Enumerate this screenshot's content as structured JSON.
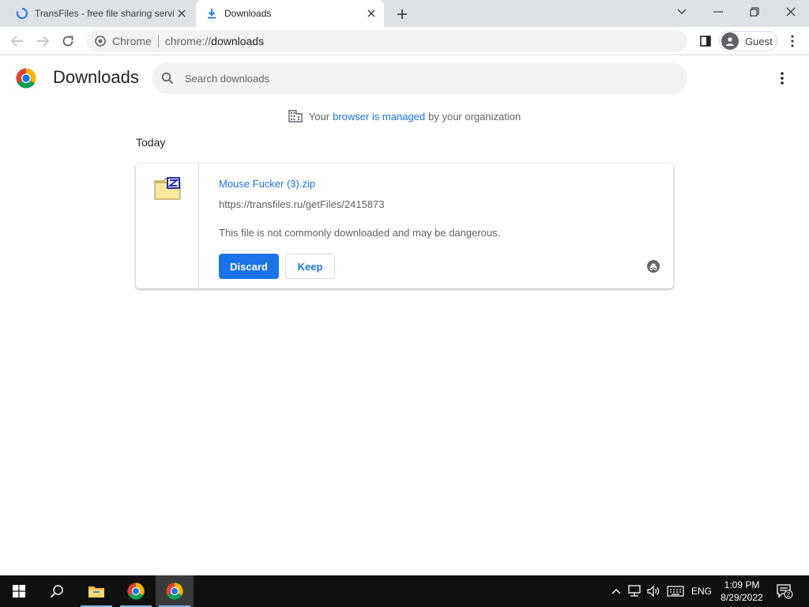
{
  "browser": {
    "tabs": [
      {
        "title": "TransFiles - free file sharing servi",
        "icon": "loading-spinner-icon",
        "active": false
      },
      {
        "title": "Downloads",
        "icon": "download-icon",
        "active": true
      }
    ],
    "omnibox": {
      "site_chip": "Chrome",
      "url_scheme": "chrome://",
      "url_path": "downloads"
    },
    "profile": {
      "label": "Guest"
    }
  },
  "page": {
    "title": "Downloads",
    "search": {
      "placeholder": "Search downloads"
    },
    "managed_notice": {
      "prefix": "Your",
      "link": "browser is managed",
      "suffix": "by your organization"
    },
    "date_group": "Today",
    "download": {
      "file_name": "Mouse Fucker (3).zip",
      "url": "https://transfiles.ru/getFiles/2415873",
      "warning": "This file is not commonly downloaded and may be dangerous.",
      "discard_label": "Discard",
      "keep_label": "Keep",
      "file_icon": "zip-archive-icon"
    }
  },
  "taskbar": {
    "items": [
      "windows-start-icon",
      "search-icon",
      "file-explorer-icon",
      "chrome-icon",
      "chrome-icon"
    ],
    "language": "ENG",
    "time": "1:09 PM",
    "date": "8/29/2022",
    "notification_count": "2"
  },
  "colors": {
    "accent": "#1a73e8",
    "tabstrip": "#dee1e6",
    "taskbar": "#101010"
  }
}
